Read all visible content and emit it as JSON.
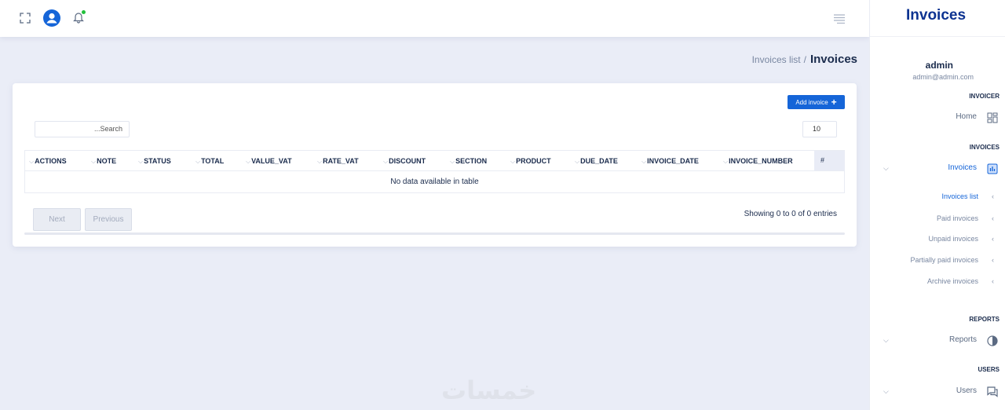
{
  "topbar": {
    "icons": [
      "fullscreen-icon",
      "user-avatar-icon",
      "bell-icon",
      "menu-icon"
    ],
    "notification_color": "#22c03c"
  },
  "breadcrumb": {
    "parent": "Invoices list",
    "separator": "/",
    "current": "Invoices"
  },
  "card": {
    "add_button_label": "Add invoice",
    "search_placeholder": "...Search",
    "page_length": "10",
    "table": {
      "columns": [
        "ACTIONS",
        "NOTE",
        "STATUS",
        "TOTAL",
        "VALUE_VAT",
        "RATE_VAT",
        "DISCOUNT",
        "SECTION",
        "PRODUCT",
        "DUE_DATE",
        "INVOICE_DATE",
        "INVOICE_NUMBER",
        "#"
      ],
      "empty_message": "No data available in table"
    },
    "pagination": {
      "next": "Next",
      "previous": "Previous",
      "info": "Showing 0 to 0 of 0 entries"
    }
  },
  "watermark": "خمسات",
  "sidebar": {
    "brand": "Invoices",
    "user": {
      "name": "admin",
      "email": "admin@admin.com"
    },
    "sections": [
      {
        "title": "INVOICER",
        "items": [
          {
            "label": "Home",
            "icon": "dashboard-icon"
          }
        ]
      },
      {
        "title": "INVOICES",
        "items": [
          {
            "label": "Invoices",
            "icon": "chart-icon",
            "expanded": true,
            "children": [
              "Invoices list",
              "Paid invoices",
              "Unpaid invoices",
              "Partially paid invoices",
              "Archive invoices"
            ]
          }
        ]
      },
      {
        "title": "REPORTS",
        "items": [
          {
            "label": "Reports",
            "icon": "pie-icon"
          }
        ]
      },
      {
        "title": "USERS",
        "items": [
          {
            "label": "Users",
            "icon": "chat-icon"
          }
        ]
      }
    ],
    "accent_color": "#1565d8",
    "brand_color": "#0d3391"
  }
}
